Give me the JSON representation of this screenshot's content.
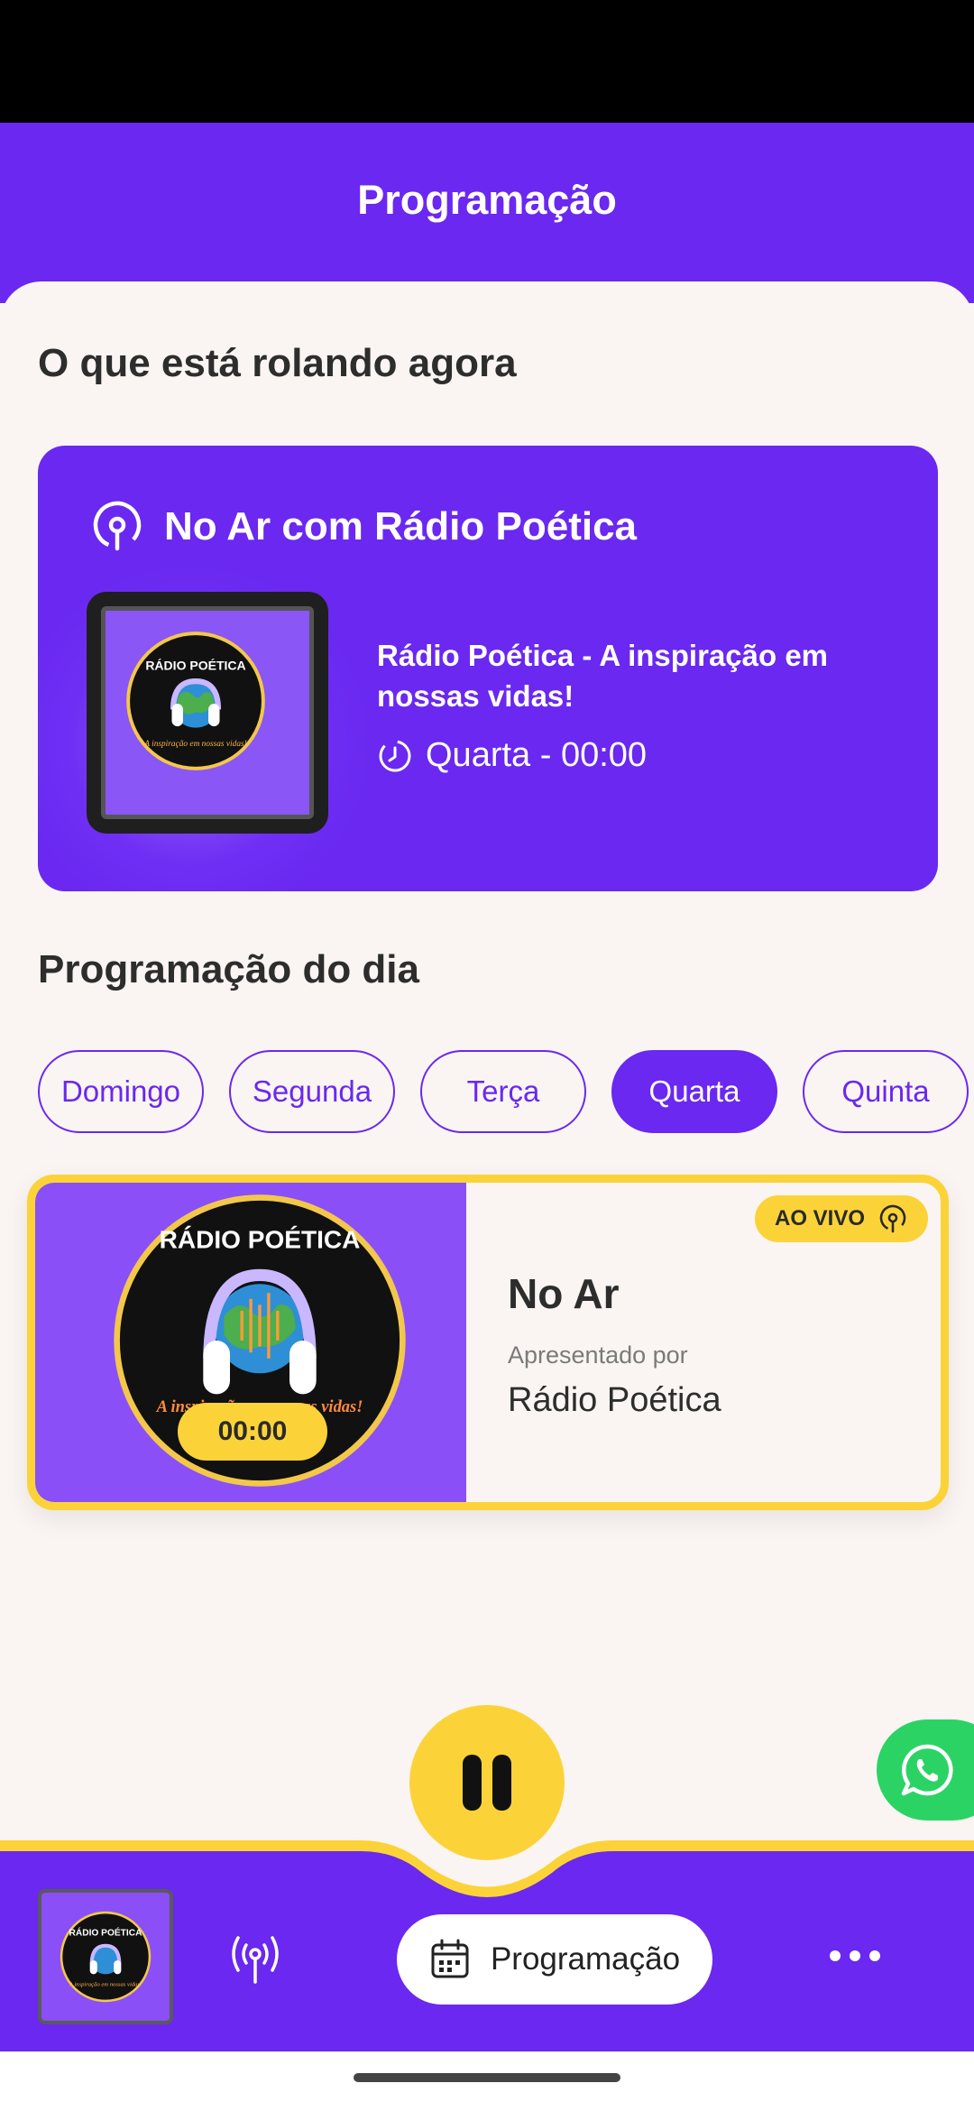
{
  "header": {
    "title": "Programação"
  },
  "now_section": {
    "title": "O que está rolando agora"
  },
  "now_playing": {
    "label": "No Ar com Rádio Poética",
    "description": "Rádio Poética - A inspiração em nossas vidas!",
    "time": "Quarta - 00:00"
  },
  "logo": {
    "name": "RÁDIO POÉTICA",
    "tagline": "A inspiração em nossas vidas!"
  },
  "day_section": {
    "title": "Programação do dia"
  },
  "days": [
    "Domingo",
    "Segunda",
    "Terça",
    "Quarta",
    "Quinta"
  ],
  "selected_day": "Quarta",
  "schedule_item": {
    "badge": "AO VIVO",
    "show_name": "No Ar",
    "presented_by": "Apresentado por",
    "host": "Rádio Poética",
    "time": "00:00"
  },
  "bottom_bar": {
    "programacao_label": "Programação"
  },
  "colors": {
    "primary": "#6a28f0",
    "accent": "#fbd339",
    "background": "#faf5f2",
    "whatsapp": "#2bd365"
  },
  "icons": {
    "live": "broadcast-pin-icon",
    "clock": "clock-icon",
    "pause": "pause-icon",
    "whatsapp": "whatsapp-icon",
    "radio": "radio-antenna-icon",
    "calendar": "calendar-icon",
    "more": "more-dots-icon"
  }
}
